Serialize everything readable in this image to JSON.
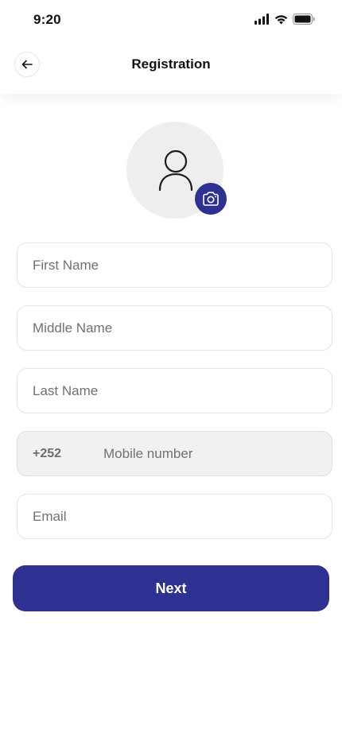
{
  "status_bar": {
    "time": "9:20",
    "icons": [
      "signal-icon",
      "wifi-icon",
      "battery-icon"
    ]
  },
  "header": {
    "back_icon": "arrow-left-icon",
    "title": "Registration"
  },
  "avatar": {
    "icon": "user-icon",
    "upload_icon": "camera-icon"
  },
  "form": {
    "first_name": {
      "placeholder": "First Name",
      "value": ""
    },
    "middle_name": {
      "placeholder": "Middle Name",
      "value": ""
    },
    "last_name": {
      "placeholder": "Last Name",
      "value": ""
    },
    "mobile": {
      "country_code": "+252",
      "placeholder": "Mobile number",
      "value": ""
    },
    "email": {
      "placeholder": "Email",
      "value": ""
    }
  },
  "actions": {
    "next_label": "Next"
  },
  "colors": {
    "primary": "#2f3192",
    "avatar_bg": "#eeeeee",
    "field_border": "#e4e4e7",
    "disabled_field_bg": "#f1f1f1",
    "placeholder": "#6f7177"
  }
}
